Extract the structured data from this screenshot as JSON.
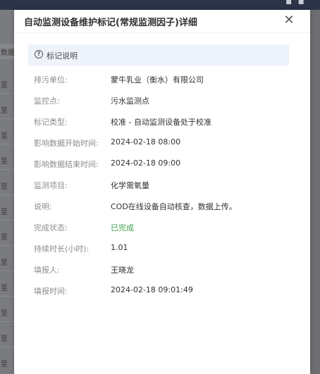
{
  "dialog": {
    "title": "自动监测设备维护标记(常规监测因子)详细",
    "close_glyph": "✕"
  },
  "legend": {
    "icon": "question-circle-icon",
    "text": "标记说明"
  },
  "fields": [
    {
      "label": "排污单位:",
      "value": "蒙牛乳业（衡水）有限公司"
    },
    {
      "label": "监控点:",
      "value": "污水监测点"
    },
    {
      "label": "标记类型:",
      "value": "校准 - 自动监测设备处于校准"
    },
    {
      "label": "影响数据开始时间:",
      "value": "2024-02-18 08:00"
    },
    {
      "label": "影响数据结束时间:",
      "value": "2024-02-18 09:00"
    },
    {
      "label": "监测项目:",
      "value": "化学需氧量"
    },
    {
      "label": "说明:",
      "value": "COD在线设备自动核查，数据上传。"
    },
    {
      "label": "完成状态:",
      "value": "已完成",
      "color": "#3fa34d"
    },
    {
      "label": "持续时长(小时):",
      "value": "1.01"
    },
    {
      "label": "填报人:",
      "value": "王晓龙"
    },
    {
      "label": "填报时间:",
      "value": "2024-02-18 09:01:49"
    }
  ],
  "backdrop": {
    "header_fragment": "数据",
    "row_fragment": "至"
  }
}
